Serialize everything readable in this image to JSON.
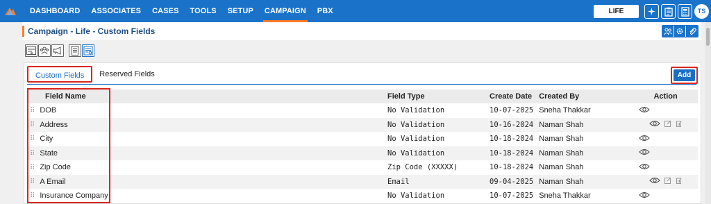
{
  "nav": {
    "items": [
      "DASHBOARD",
      "ASSOCIATES",
      "CASES",
      "TOOLS",
      "SETUP",
      "CAMPAIGN",
      "PBX"
    ],
    "active": "CAMPAIGN",
    "lob": "LIFE",
    "avatar_initials": "TS",
    "icons": [
      "sparkle-icon",
      "clipboard-icon",
      "calculator-icon"
    ]
  },
  "page": {
    "title": "Campaign - Life - Custom Fields",
    "title_icons": [
      "people-icon",
      "settings-icon",
      "attachment-icon"
    ]
  },
  "toolbar": {
    "icons": [
      "form-icon",
      "users-icon",
      "megaphone-icon",
      "document-icon",
      "list-settings-icon"
    ]
  },
  "tabs": [
    {
      "label": "Custom Fields",
      "active": true
    },
    {
      "label": "Reserved Fields",
      "active": false
    }
  ],
  "add_label": "Add",
  "table": {
    "headers": {
      "field_name": "Field Name",
      "field_type": "Field Type",
      "create_date": "Create Date",
      "created_by": "Created By",
      "action": "Action"
    },
    "rows": [
      {
        "name": "DOB",
        "type": "No Validation",
        "date": "10-07-2025",
        "by": "Sneha Thakkar",
        "editable": false
      },
      {
        "name": "Address",
        "type": "No Validation",
        "date": "10-16-2024",
        "by": "Naman Shah",
        "editable": true
      },
      {
        "name": "City",
        "type": "No Validation",
        "date": "10-18-2024",
        "by": "Naman Shah",
        "editable": false
      },
      {
        "name": "State",
        "type": "No Validation",
        "date": "10-18-2024",
        "by": "Naman Shah",
        "editable": false
      },
      {
        "name": "Zip Code",
        "type": "Zip Code (XXXXX)",
        "date": "10-18-2024",
        "by": "Naman Shah",
        "editable": false
      },
      {
        "name": "A Email",
        "type": "Email",
        "date": "09-04-2025",
        "by": "Naman Shah",
        "editable": true
      },
      {
        "name": "Insurance Company",
        "type": "No Validation",
        "date": "10-07-2025",
        "by": "Sneha Thakkar",
        "editable": false
      }
    ]
  },
  "colors": {
    "primary": "#1a73c9",
    "accent": "#ff7a29",
    "highlight": "#d9261c"
  }
}
